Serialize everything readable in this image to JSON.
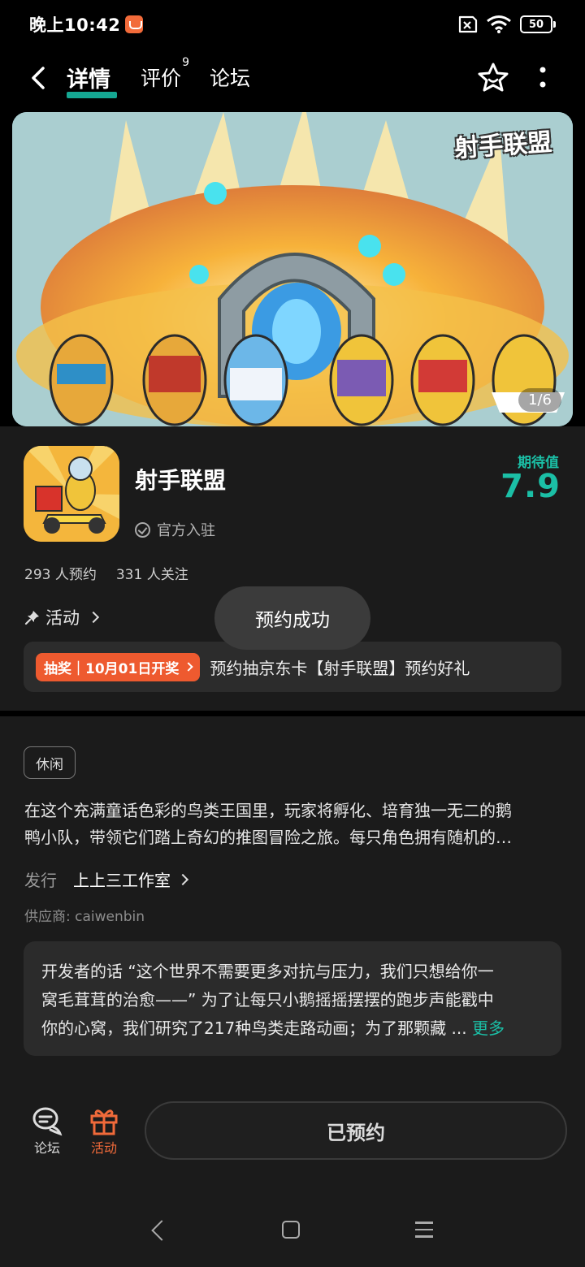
{
  "status_bar": {
    "time": "晚上10:42",
    "battery": "50"
  },
  "nav": {
    "tabs": [
      {
        "label": "详情",
        "active": true
      },
      {
        "label": "评价",
        "badge": "9"
      },
      {
        "label": "论坛"
      }
    ]
  },
  "banner": {
    "logo_text": "射手联盟",
    "counter": "1/6"
  },
  "app": {
    "name": "射手联盟",
    "official_label": "官方入驻",
    "score_label": "期待值",
    "score_value": "7.9",
    "reservations": "293 人预约",
    "followers": "331 人关注"
  },
  "activity": {
    "label": "活动",
    "promo_tag": "抽奖｜10月01日开奖",
    "promo_text": "预约抽京东卡【射手联盟】预约好礼"
  },
  "toast": {
    "text": "预约成功"
  },
  "details": {
    "genre": "休闲",
    "description_lines": [
      "在这个充满童话色彩的鸟类王国里，玩家将孵化、培育独一无二的鹅",
      "鸭小队，带领它们踏上奇幻的推图冒险之旅。每只角色拥有随机的…"
    ],
    "publisher_label": "发行",
    "publisher_name": "上上三工作室",
    "supplier": "供应商: caiwenbin"
  },
  "developer_note": {
    "lines": [
      "开发者的话 “这个世界不需要更多对抗与压力，我们只想给你一",
      "窝毛茸茸的治愈——” 为了让每只小鹅摇摇摆摆的跑步声能戳中",
      "你的心窝，我们研究了217种鸟类走路动画；为了那颗藏 ..."
    ],
    "more_label": "更多"
  },
  "action_bar": {
    "forum_label": "论坛",
    "activity_label": "活动",
    "reserve_label": "已预约"
  },
  "colors": {
    "accent": "#1bbfa6",
    "orange": "#ee5a2f",
    "panel": "#1b1b1b"
  }
}
